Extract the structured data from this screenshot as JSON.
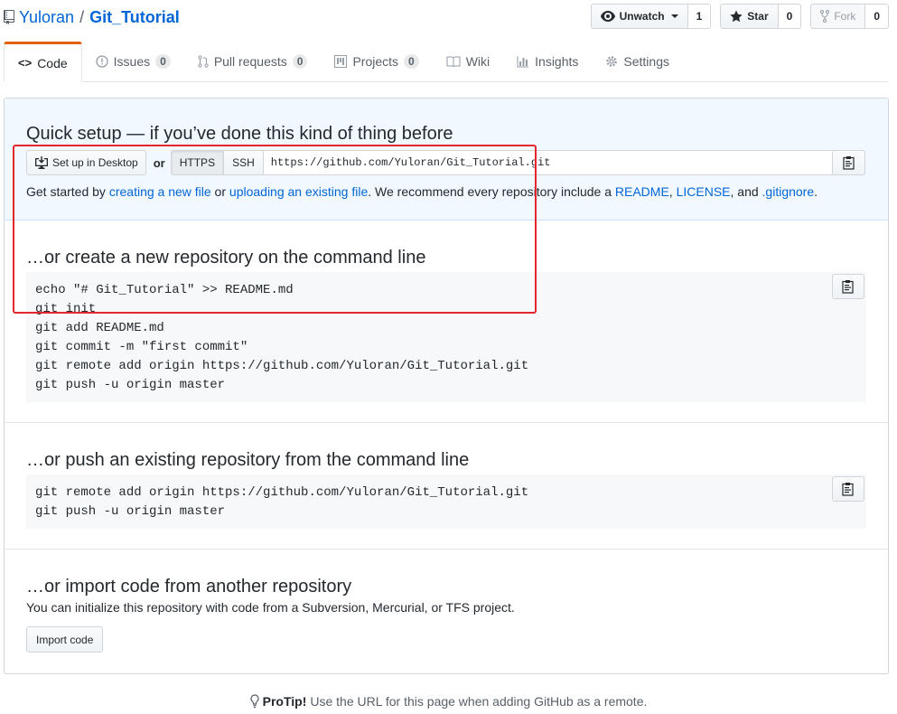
{
  "repo": {
    "owner": "Yuloran",
    "separator": "/",
    "name": "Git_Tutorial"
  },
  "actions": {
    "watch": {
      "label": "Unwatch",
      "count": "1"
    },
    "star": {
      "label": "Star",
      "count": "0"
    },
    "fork": {
      "label": "Fork",
      "count": "0"
    }
  },
  "tabs": [
    {
      "label": "Code",
      "icon": "code-icon"
    },
    {
      "label": "Issues",
      "count": "0",
      "icon": "issue-icon"
    },
    {
      "label": "Pull requests",
      "count": "0",
      "icon": "pull-request-icon"
    },
    {
      "label": "Projects",
      "count": "0",
      "icon": "project-icon"
    },
    {
      "label": "Wiki",
      "icon": "book-icon"
    },
    {
      "label": "Insights",
      "icon": "graph-icon"
    },
    {
      "label": "Settings",
      "icon": "gear-icon"
    }
  ],
  "quick_setup": {
    "title": "Quick setup — if you’ve done this kind of thing before",
    "desktop_button": "Set up in Desktop",
    "or": "or",
    "https": "HTTPS",
    "ssh": "SSH",
    "url": "https://github.com/Yuloran/Git_Tutorial.git",
    "started": {
      "prefix": "Get started by ",
      "link1": "creating a new file",
      "mid": " or ",
      "link2": "uploading an existing file",
      "text2": ". We recommend every repository include a ",
      "readme": "README",
      "comma1": ", ",
      "license": "LICENSE",
      "and": ", and ",
      "gitignore": ".gitignore",
      "end": "."
    }
  },
  "new_repo": {
    "title": "…or create a new repository on the command line",
    "code": "echo \"# Git_Tutorial\" >> README.md\ngit init\ngit add README.md\ngit commit -m \"first commit\"\ngit remote add origin https://github.com/Yuloran/Git_Tutorial.git\ngit push -u origin master"
  },
  "push_existing": {
    "title": "…or push an existing repository from the command line",
    "code": "git remote add origin https://github.com/Yuloran/Git_Tutorial.git\ngit push -u origin master"
  },
  "import": {
    "title": "…or import code from another repository",
    "description": "You can initialize this repository with code from a Subversion, Mercurial, or TFS project.",
    "button": "Import code"
  },
  "protip": {
    "label": "ProTip!",
    "text": "Use the URL for this page when adding GitHub as a remote."
  },
  "colors": {
    "accent_tab": "#e36209",
    "link": "#0366d6",
    "highlight": "#e4262d"
  }
}
